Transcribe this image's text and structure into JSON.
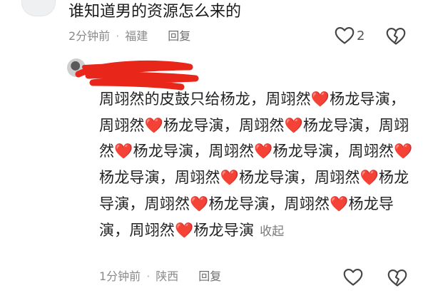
{
  "top_comment": {
    "text": "谁知道男的资源怎么来的",
    "time": "2分钟前",
    "location": "福建",
    "reply_label": "回复",
    "like_count": "2"
  },
  "reply_comment": {
    "username": "",
    "text": "周翊然的皮鼓只给杨龙，周翊然❤️杨龙导演，周翊然❤️杨龙导演，周翊然❤️杨龙导演，周翊然❤️杨龙导演，周翊然❤️杨龙导演，周翊然❤️杨龙导演，周翊然❤️杨龙导演，周翊然❤️杨龙导演，周翊然❤️杨龙导演，周翊然❤️杨龙导演，周翊然❤️杨龙导演",
    "collapse_label": "收起",
    "time": "1分钟前",
    "location": "陕西",
    "reply_label": "回复"
  },
  "icons": {
    "like": "heart-outline-icon",
    "dislike": "broken-heart-icon"
  },
  "colors": {
    "text": "#1a1a1a",
    "meta": "#8a8a8a",
    "heart": "#e0202a",
    "redact": "#e8271a"
  }
}
